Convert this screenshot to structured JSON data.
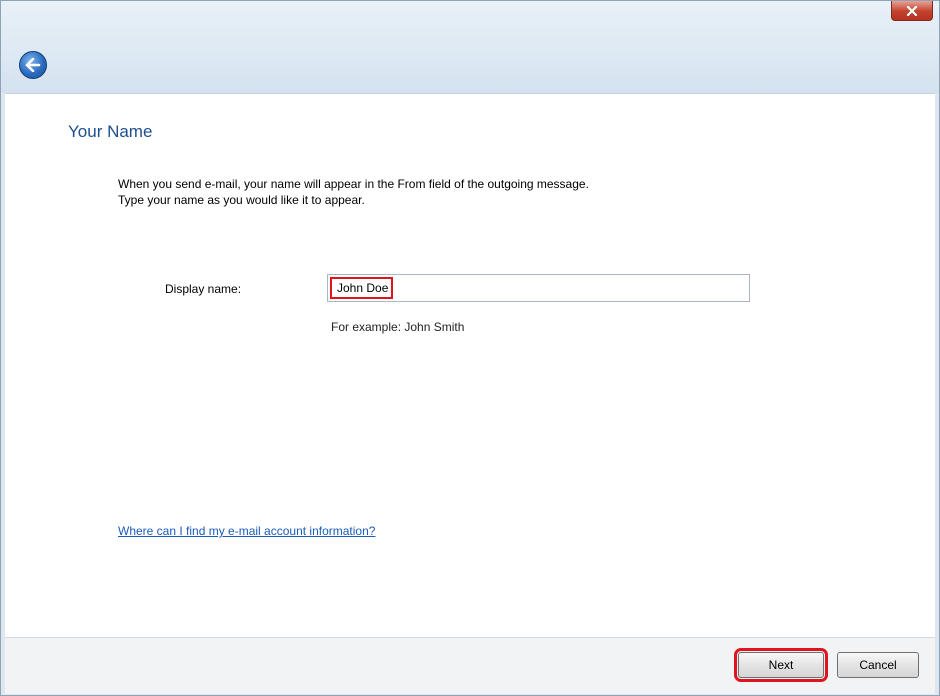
{
  "window": {
    "close_icon": "close-x-icon",
    "back_icon": "back-arrow-icon",
    "accent": "#1f4e8f",
    "highlight": "#e0141e"
  },
  "page": {
    "heading": "Your Name",
    "instructions": [
      "When you send e-mail, your name will appear in the From field of the outgoing message.",
      "Type your name as you would like it to appear."
    ]
  },
  "form": {
    "display_name_label": "Display name:",
    "display_name_value": "John Doe",
    "example_text": "For example: John Smith"
  },
  "links": {
    "help": "Where can I find my e-mail account information?"
  },
  "buttons": {
    "next": "Next",
    "cancel": "Cancel"
  }
}
